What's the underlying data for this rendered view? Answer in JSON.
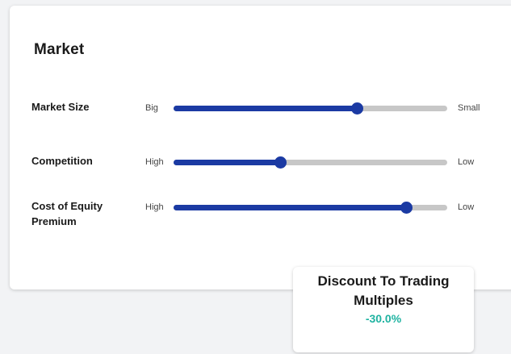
{
  "market": {
    "title": "Market",
    "sliders": [
      {
        "label": "Market Size",
        "left_label": "Big",
        "right_label": "Small",
        "value": 0.67
      },
      {
        "label": "Competition",
        "left_label": "High",
        "right_label": "Low",
        "value": 0.39
      },
      {
        "label": "Cost of Equity Premium",
        "left_label": "High",
        "right_label": "Low",
        "value": 0.85
      }
    ]
  },
  "result": {
    "title": "Discount To Trading Multiples",
    "value": "-30.0%"
  },
  "colors": {
    "accent": "#1b3aa3",
    "track": "#c7c7c7",
    "value": "#1fb3a1"
  }
}
